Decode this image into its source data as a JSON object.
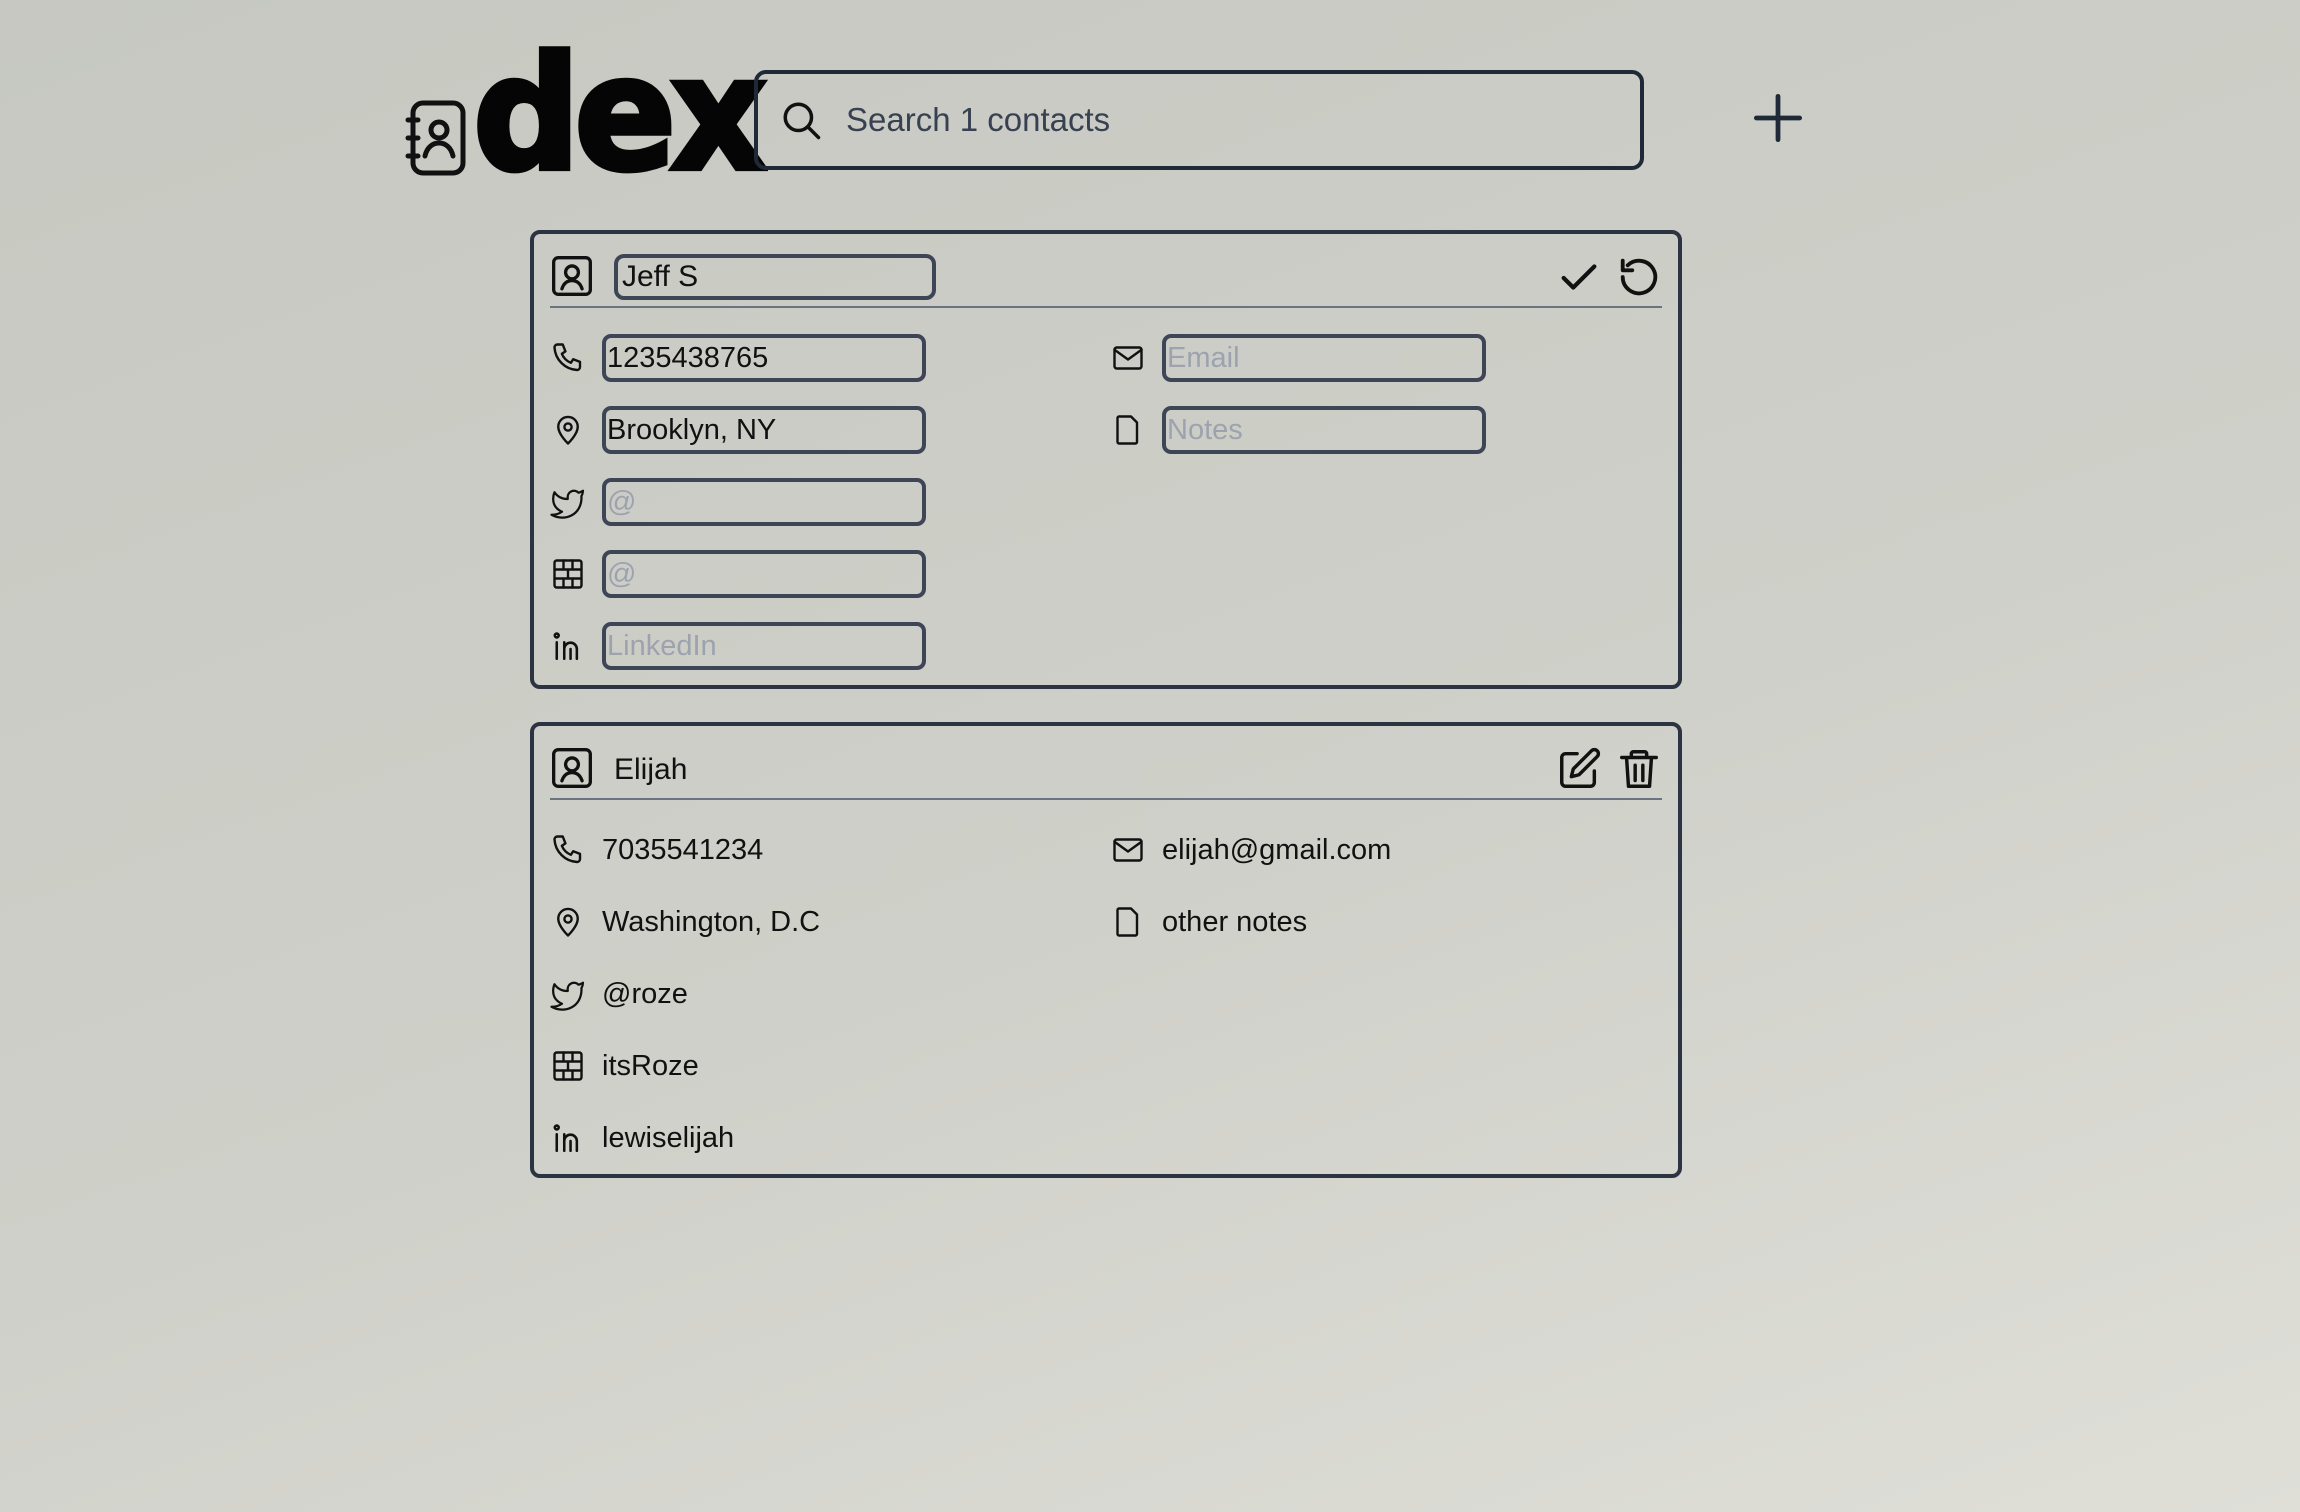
{
  "app": {
    "logo_text": "dex"
  },
  "search": {
    "placeholder": "Search 1 contacts",
    "value": ""
  },
  "add_button": {
    "icon": "plus-icon"
  },
  "editing_contact": {
    "name": "Jeff S",
    "phone": "1235438765",
    "email": "",
    "email_placeholder": "Email",
    "location": "Brooklyn, NY",
    "notes": "",
    "notes_placeholder": "Notes",
    "twitter": "",
    "twitter_placeholder": "@",
    "github": "",
    "github_placeholder": "@",
    "linkedin": "",
    "linkedin_placeholder": "LinkedIn",
    "actions": [
      "check-icon",
      "rotate-ccw-icon"
    ]
  },
  "contacts": [
    {
      "name": "Elijah",
      "phone": "7035541234",
      "email": "elijah@gmail.com",
      "location": "Washington, D.C",
      "notes": "other notes",
      "twitter": "@roze",
      "github": "itsRoze",
      "linkedin": "lewiselijah",
      "actions": [
        "edit-icon",
        "trash-icon"
      ]
    }
  ]
}
